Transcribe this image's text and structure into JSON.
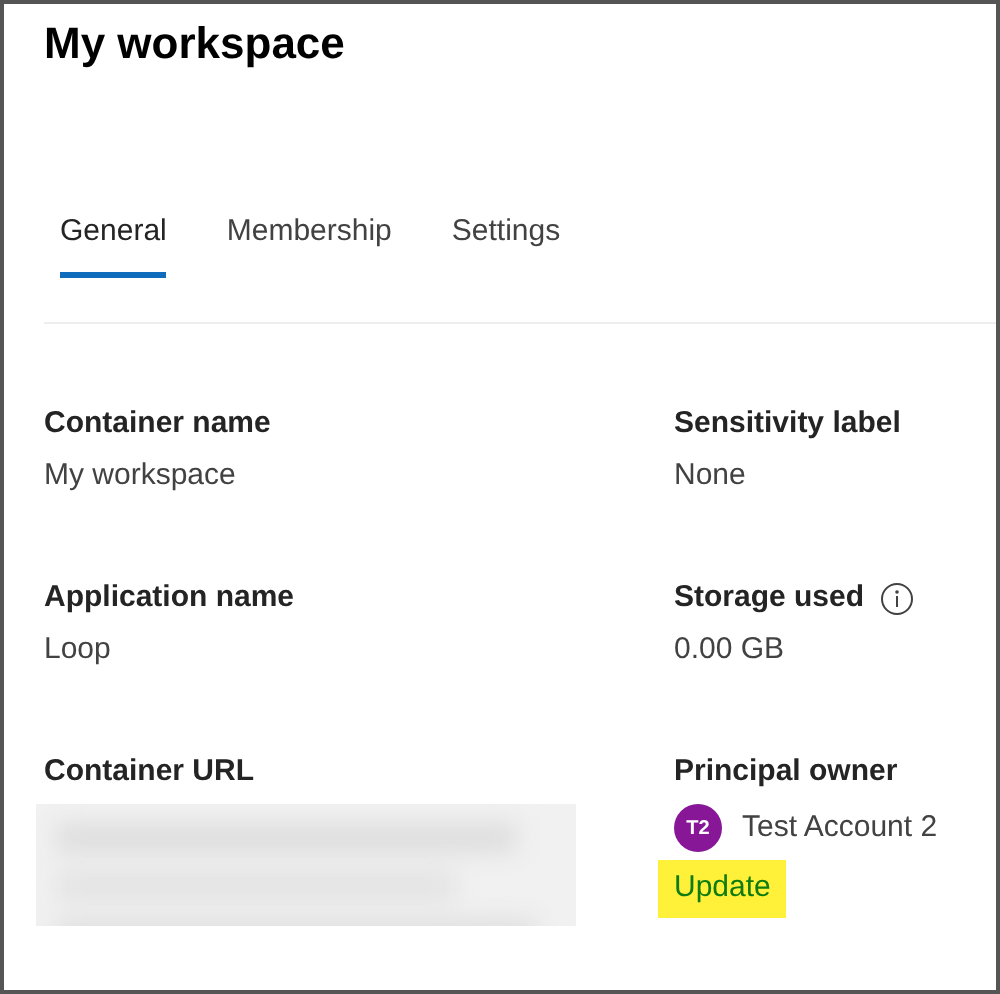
{
  "title": "My workspace",
  "tabs": [
    {
      "label": "General",
      "selected": true
    },
    {
      "label": "Membership",
      "selected": false
    },
    {
      "label": "Settings",
      "selected": false
    }
  ],
  "fields": [
    {
      "kind": "text",
      "label": "Container name",
      "value": "My workspace"
    },
    {
      "kind": "text",
      "label": "Sensitivity label",
      "value": "None"
    },
    {
      "kind": "text",
      "label": "Application name",
      "value": "Loop"
    },
    {
      "kind": "text",
      "label": "Storage used",
      "value": "0.00 GB",
      "info": true
    },
    {
      "kind": "redacted",
      "label": "Container URL"
    },
    {
      "kind": "owner",
      "label": "Principal owner",
      "initials": "T2",
      "color": "#881798",
      "name": "Test Account 2",
      "action": "Update",
      "highlighted": true
    }
  ]
}
